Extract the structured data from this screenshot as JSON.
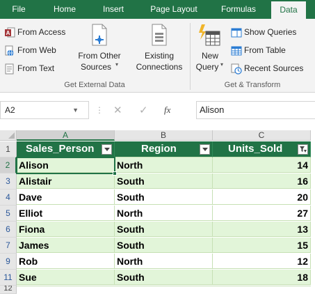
{
  "ribbon_tabs": [
    {
      "label": "File"
    },
    {
      "label": "Home"
    },
    {
      "label": "Insert"
    },
    {
      "label": "Page Layout"
    },
    {
      "label": "Formulas"
    },
    {
      "label": "Data",
      "active": true
    }
  ],
  "get_external_data": {
    "from_access": "From Access",
    "from_web": "From Web",
    "from_text": "From Text",
    "from_other_sources_line1": "From Other",
    "from_other_sources_line2": "Sources",
    "existing_connections_line1": "Existing",
    "existing_connections_line2": "Connections",
    "group_label": "Get External Data"
  },
  "get_transform": {
    "new_query_line1": "New",
    "new_query_line2": "Query",
    "show_queries": "Show Queries",
    "from_table": "From Table",
    "recent_sources": "Recent Sources",
    "group_label": "Get & Transform"
  },
  "formula_bar": {
    "name_box": "A2",
    "fx_label": "fx",
    "content": "Alison"
  },
  "sheet": {
    "corner": "",
    "column_headers": [
      "A",
      "B",
      "C"
    ],
    "row_numbers": [
      "1",
      "2",
      "3",
      "4",
      "5",
      "6",
      "7",
      "9",
      "11"
    ],
    "partial_row_number": "12",
    "table_headers": [
      "Sales_Person",
      "Region",
      "Units_Sold"
    ],
    "rows": [
      {
        "sales_person": "Alison",
        "region": "North",
        "units_sold": "14",
        "shaded": true
      },
      {
        "sales_person": "Alistair",
        "region": "South",
        "units_sold": "16",
        "shaded": true
      },
      {
        "sales_person": "Dave",
        "region": "South",
        "units_sold": "20",
        "shaded": false
      },
      {
        "sales_person": "Elliot",
        "region": "North",
        "units_sold": "27",
        "shaded": false
      },
      {
        "sales_person": "Fiona",
        "region": "South",
        "units_sold": "13",
        "shaded": true
      },
      {
        "sales_person": "James",
        "region": "South",
        "units_sold": "15",
        "shaded": true
      },
      {
        "sales_person": "Rob",
        "region": "North",
        "units_sold": "12",
        "shaded": false
      },
      {
        "sales_person": "Sue",
        "region": "South",
        "units_sold": "18",
        "shaded": true
      }
    ],
    "active_cell": "A2"
  },
  "colors": {
    "excel_green": "#217346",
    "band_light": "#e2f5d9",
    "band_white": "#ffffff",
    "header_text": "#ffffff"
  },
  "icons": {
    "from_access": "access-db-icon",
    "from_web": "web-globe-icon",
    "from_text": "text-file-icon",
    "from_other": "other-sources-icon",
    "existing_connections": "connections-icon",
    "new_query": "new-query-icon",
    "show_queries": "queries-pane-icon",
    "from_table": "table-icon",
    "recent_sources": "recent-clock-icon",
    "filter": "filter-dropdown-icon",
    "filter_applied": "filter-applied-icon"
  }
}
